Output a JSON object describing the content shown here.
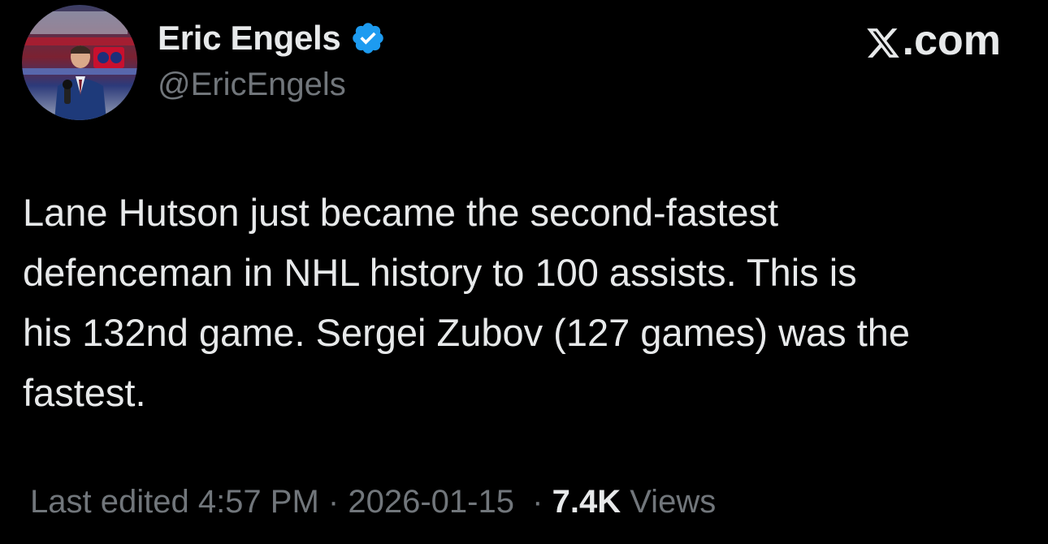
{
  "author": {
    "display_name": "Eric Engels",
    "handle": "@EricEngels",
    "verified": true,
    "verified_color": "#1d9bf0"
  },
  "site": {
    "label": ".com",
    "logo_icon": "x-logo-icon"
  },
  "tweet": {
    "text": "Lane Hutson just became the second-fastest\ndefenceman in NHL history to 100 assists. This is\nhis 132nd game. Sergei Zubov (127 games) was the\nfastest."
  },
  "meta": {
    "edited_label": "Last edited 4:57 PM",
    "separator": " · ",
    "date": "2026-01-15",
    "separator2": "  · ",
    "views_count": "7.4K",
    "views_label": " Views"
  },
  "colors": {
    "background": "#000000",
    "primary_text": "#e7e9ea",
    "secondary_text": "#71767b"
  }
}
